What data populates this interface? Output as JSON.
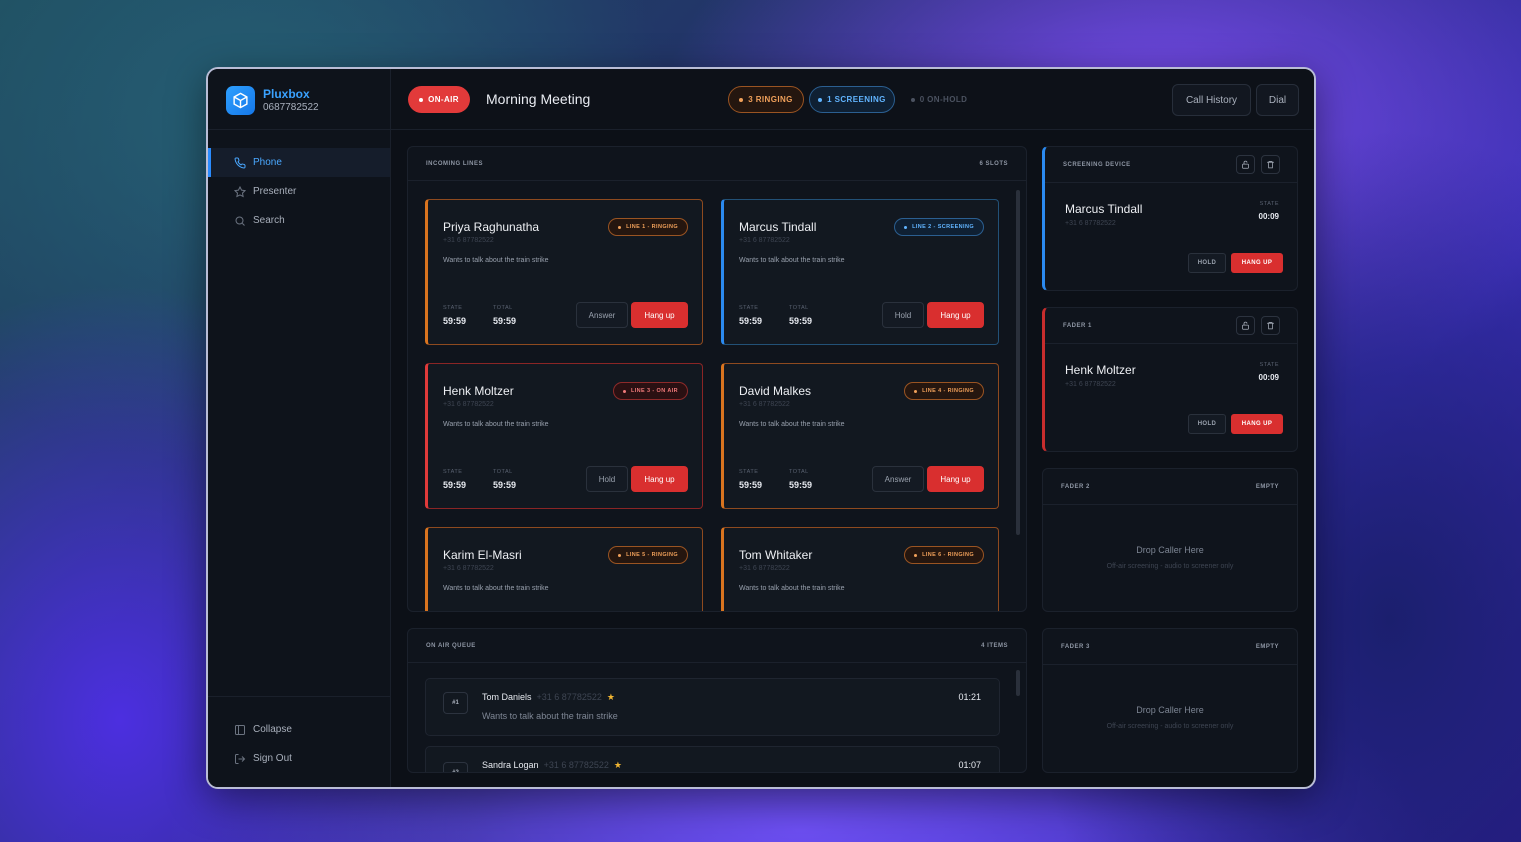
{
  "brand": {
    "name": "Pluxbox",
    "number": "0687782522"
  },
  "sidebar": {
    "items": [
      {
        "label": "Phone",
        "icon": "phone-icon"
      },
      {
        "label": "Presenter",
        "icon": "star-icon"
      },
      {
        "label": "Search",
        "icon": "search-icon"
      }
    ],
    "bottom": [
      {
        "label": "Collapse",
        "icon": "collapse-icon"
      },
      {
        "label": "Sign Out",
        "icon": "sign-out-icon"
      }
    ]
  },
  "topbar": {
    "onair": "ON-AIR",
    "title": "Morning Meeting",
    "ringing": "3 RINGING",
    "screening": "1 SCREENING",
    "onhold": "0 ON-HOLD",
    "call_history": "Call History",
    "dial": "Dial"
  },
  "incoming": {
    "title": "INCOMING LINES",
    "count": "6 SLOTS",
    "state_label": "STATE",
    "total_label": "TOTAL",
    "cards": [
      {
        "name": "Priya Raghunatha",
        "phone": "+31 6 87782522",
        "desc": "Wants to talk about the train strike",
        "badge": "LINE 1 - RINGING",
        "state": "59:59",
        "total": "59:59",
        "btn1": "Answer",
        "btn2": "Hang up"
      },
      {
        "name": "Marcus Tindall",
        "phone": "+31 6 87782522",
        "desc": "Wants to talk about the train strike",
        "badge": "LINE 2 - SCREENING",
        "state": "59:59",
        "total": "59:59",
        "btn1": "Hold",
        "btn2": "Hang up"
      },
      {
        "name": "Henk Moltzer",
        "phone": "+31 6 87782522",
        "desc": "Wants to talk about the train strike",
        "badge": "LINE 3 - ON AIR",
        "state": "59:59",
        "total": "59:59",
        "btn1": "Hold",
        "btn2": "Hang up"
      },
      {
        "name": "David Malkes",
        "phone": "+31 6 87782522",
        "desc": "Wants to talk about the train strike",
        "badge": "LINE 4 - RINGING",
        "state": "59:59",
        "total": "59:59",
        "btn1": "Answer",
        "btn2": "Hang up"
      },
      {
        "name": "Karim El-Masri",
        "phone": "+31 6 87782522",
        "desc": "Wants to talk about the train strike",
        "badge": "LINE 5 - RINGING"
      },
      {
        "name": "Tom Whitaker",
        "phone": "+31 6 87782522",
        "desc": "Wants to talk about the train strike",
        "badge": "LINE 6 - RINGING"
      }
    ]
  },
  "queue": {
    "title": "ON AIR QUEUE",
    "count": "4 ITEMS",
    "items": [
      {
        "idx": "#1",
        "name": "Tom Daniels",
        "phone": "+31 6 87782522",
        "desc": "Wants to talk about the train strike",
        "time": "01:21"
      },
      {
        "idx": "#2",
        "name": "Sandra Logan",
        "phone": "+31 6 87782522",
        "time": "01:07"
      }
    ]
  },
  "right": {
    "screening": {
      "title": "SCREENING DEVICE",
      "name": "Marcus Tindall",
      "phone": "+31 6 87782522",
      "state_label": "STATE",
      "state": "00:09",
      "hold": "HOLD",
      "hangup": "HANG UP"
    },
    "fader1": {
      "title": "FADER 1",
      "name": "Henk Moltzer",
      "phone": "+31 6 87782522",
      "state_label": "STATE",
      "state": "00:09",
      "hold": "HOLD",
      "hangup": "HANG UP"
    },
    "fader2": {
      "title": "FADER 2",
      "status": "EMPTY",
      "drop": "Drop Caller Here",
      "hint": "Off-air screening - audio to screener only"
    },
    "fader3": {
      "title": "FADER 3",
      "status": "EMPTY",
      "drop": "Drop Caller Here",
      "hint": "Off-air screening - audio to screener only"
    }
  }
}
